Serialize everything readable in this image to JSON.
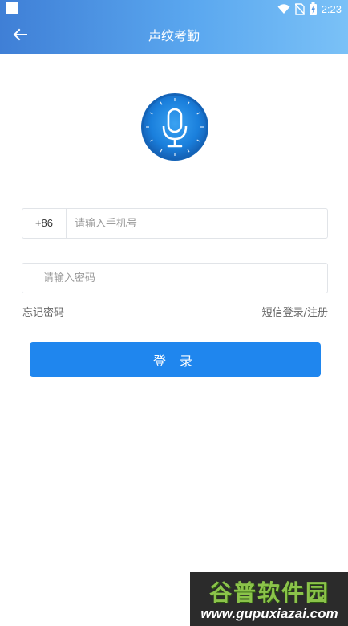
{
  "status_bar": {
    "time": "2:23",
    "icons": [
      "wifi-icon",
      "no-sim-icon",
      "battery-charging-icon"
    ]
  },
  "header": {
    "title": "声纹考勤",
    "back_icon": "arrow-left-icon"
  },
  "logo": {
    "icon": "microphone-icon"
  },
  "form": {
    "country_code": "+86",
    "phone_placeholder": "请输入手机号",
    "phone_value": "",
    "password_placeholder": "请输入密码",
    "password_value": "",
    "forgot_password": "忘记密码",
    "sms_login_register": "短信登录/注册",
    "login_button": "登 录"
  },
  "colors": {
    "header_gradient_start": "#3f7fd6",
    "header_gradient_end": "#7ac1f7",
    "primary_button": "#1f86ee",
    "link_text": "#666666"
  },
  "watermark": {
    "title": "谷普软件园",
    "url": "www.gupuxiazai.com"
  }
}
